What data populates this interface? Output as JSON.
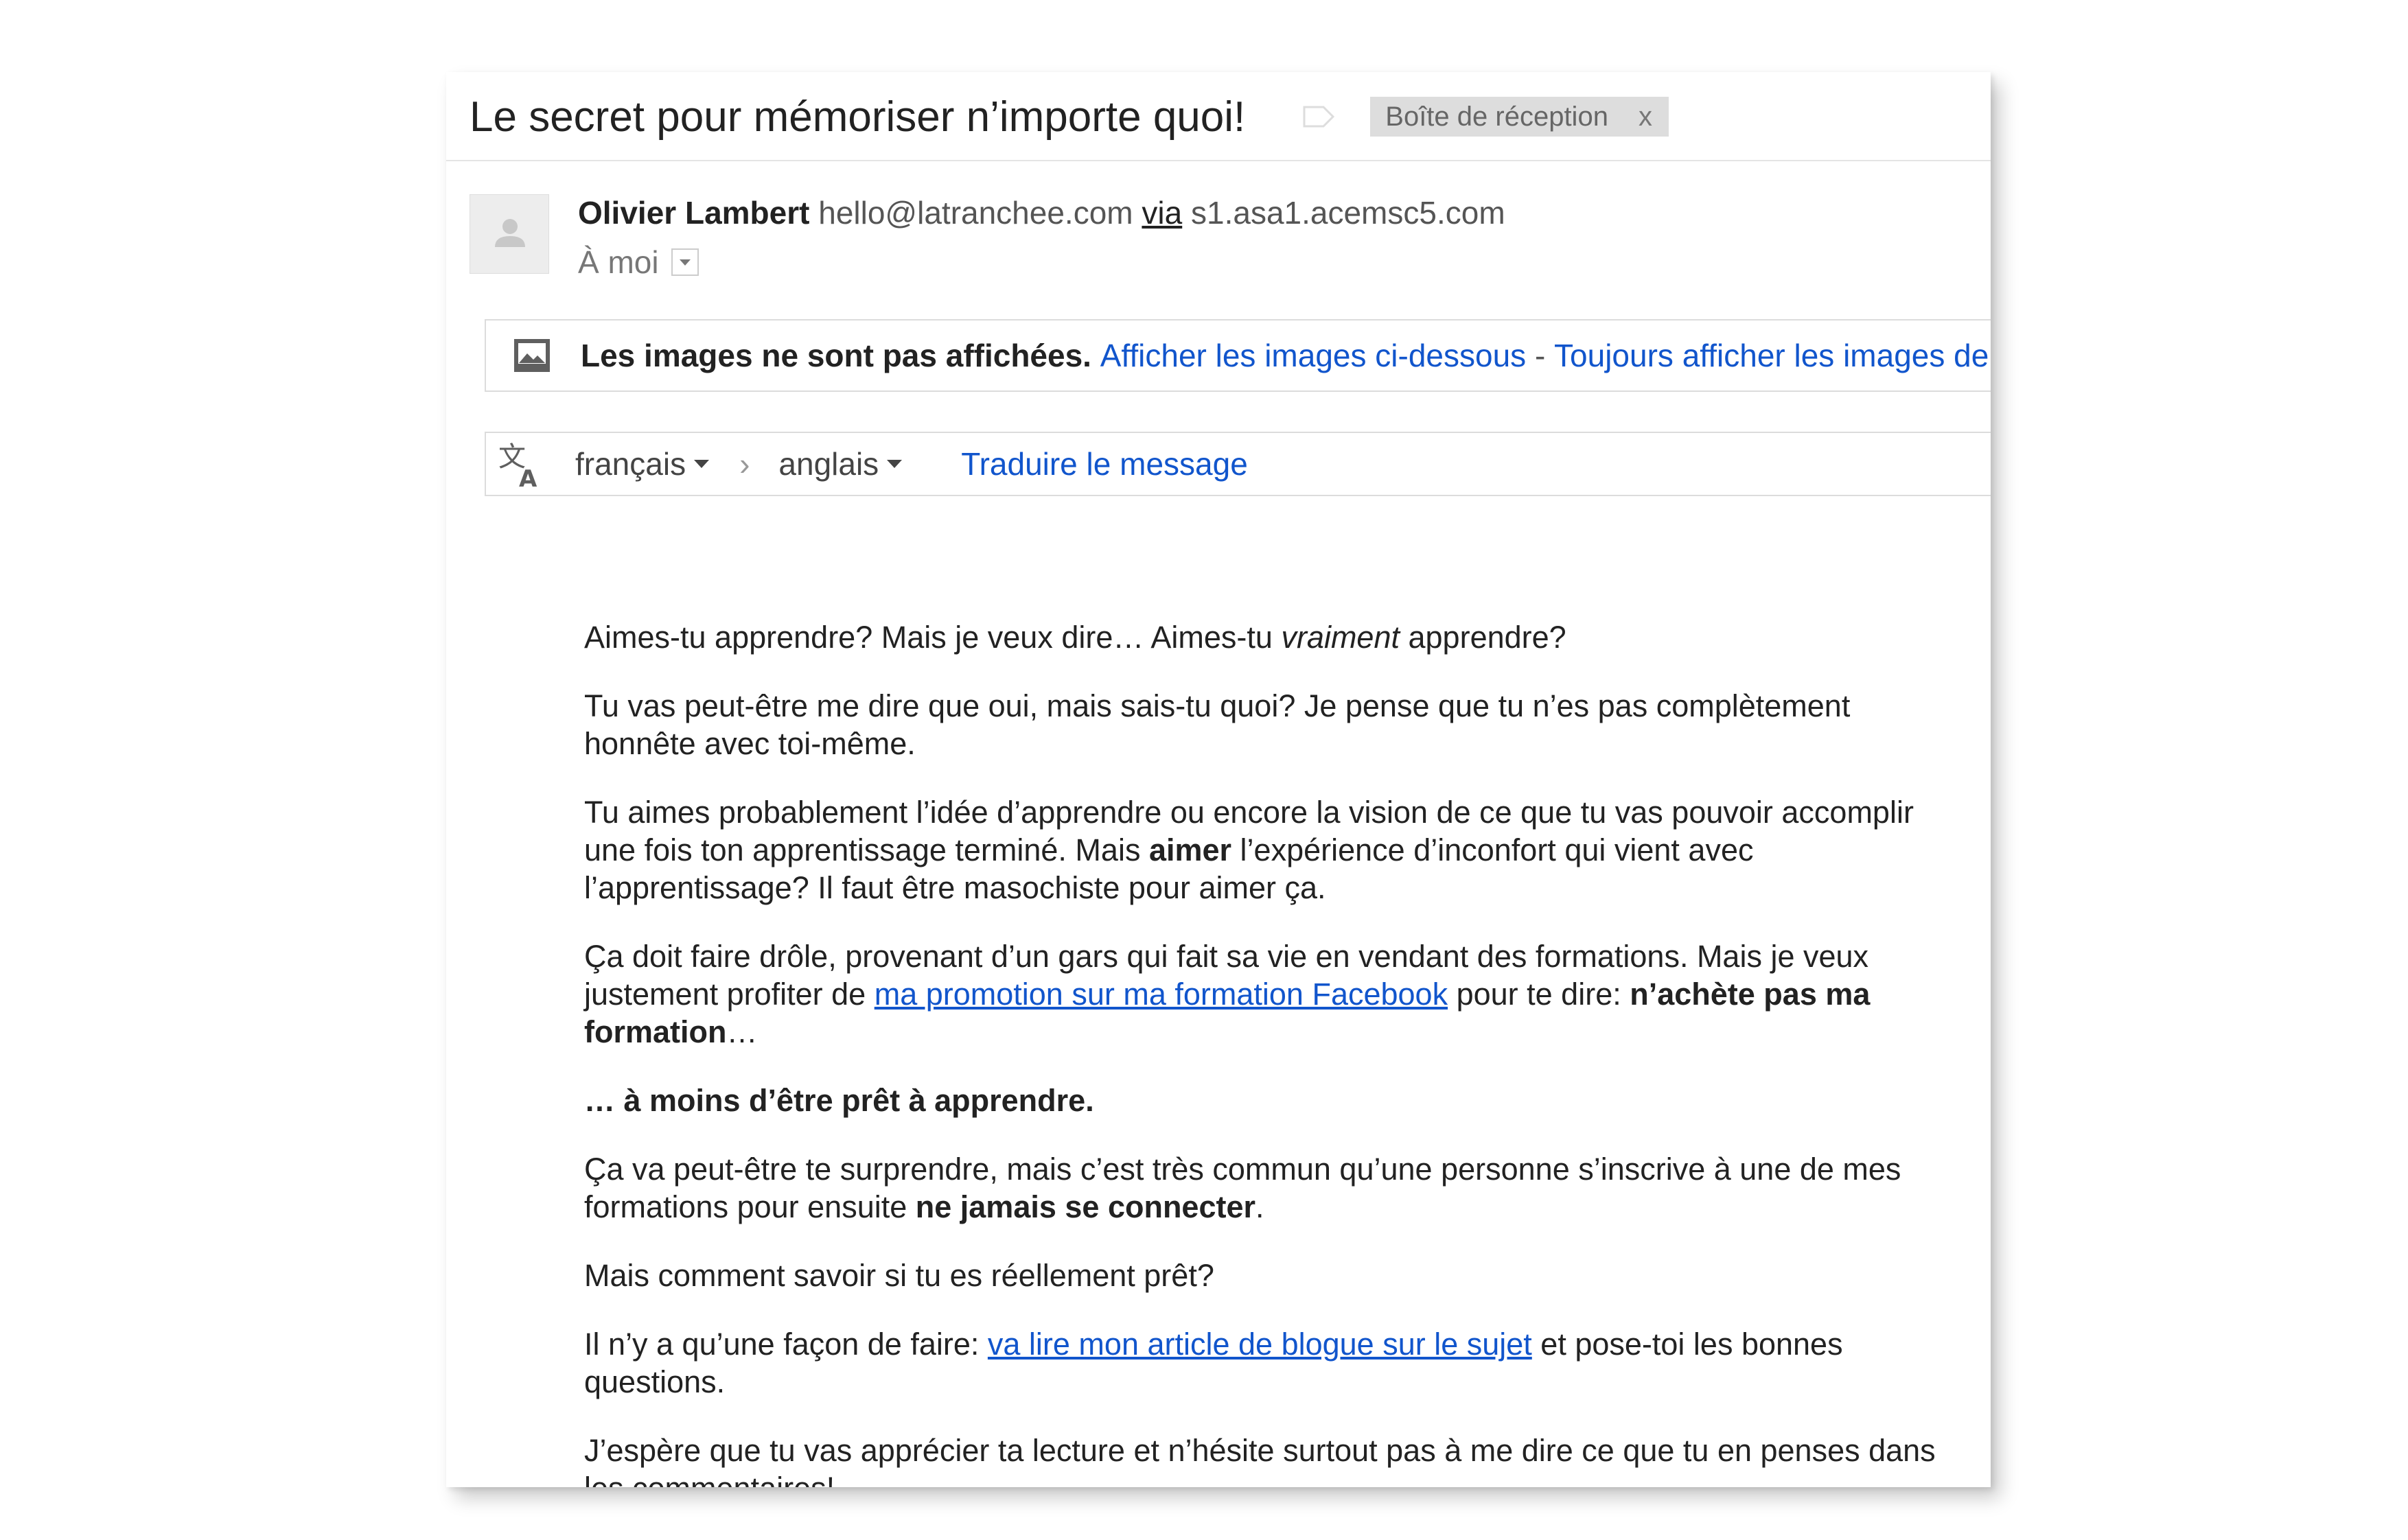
{
  "email": {
    "subject": "Le secret pour mémoriser n’importe quoi!",
    "label_chip": "Boîte de réception",
    "label_close": "x",
    "sender_name": "Olivier Lambert",
    "sender_email": "hello@latranchee.com",
    "via_label": "via",
    "via_domain": "s1.asa1.acemsc5.com",
    "to_label": "À moi"
  },
  "images_bar": {
    "notice": "Les images ne sont pas affichées.",
    "show_link": "Afficher les images ci-dessous",
    "separator": "-",
    "always_link": "Toujours afficher les images de"
  },
  "translate_bar": {
    "from_lang": "français",
    "to_lang": "anglais",
    "chevron": "›",
    "translate_link": "Traduire le message"
  },
  "body": {
    "p1_a": "Aimes-tu apprendre? Mais je veux dire… Aimes-tu ",
    "p1_em": "vraiment",
    "p1_b": " apprendre?",
    "p2": "Tu vas peut-être me dire que oui, mais sais-tu quoi? Je pense que tu n’es pas complètement honnête avec toi-même.",
    "p3_a": "Tu aimes probablement l’idée d’apprendre ou encore la vision de ce que tu vas pouvoir accomplir une fois ton apprentissage terminé. Mais ",
    "p3_strong": "aimer",
    "p3_b": " l’expérience d’inconfort qui vient avec l’apprentissage? Il faut être masochiste pour aimer ça.",
    "p4_a": "Ça doit faire drôle, provenant d’un gars qui fait sa vie en vendant des formations. Mais je veux justement profiter de ",
    "p4_link": "ma promotion sur ma formation Facebook",
    "p4_b": " pour te dire: ",
    "p4_strong": "n’achète pas ma formation",
    "p4_c": "…",
    "p5": "… à moins d’être prêt à apprendre.",
    "p6_a": "Ça va peut-être te surprendre, mais c’est très commun qu’une personne s’inscrive à une de mes formations pour ensuite ",
    "p6_strong": "ne jamais se connecter",
    "p6_b": ".",
    "p7": "Mais comment savoir si tu es réellement prêt?",
    "p8_a": "Il n’y a qu’une façon de faire: ",
    "p8_link": "va lire mon article de blogue sur le sujet",
    "p8_b": " et pose-toi les bonnes questions.",
    "p9": "J’espère que tu vas apprécier ta lecture et n’hésite surtout pas à me dire ce que tu en penses dans les commentaires!"
  },
  "colors": {
    "link": "#1155cc",
    "chip_bg": "#dddddd",
    "text": "#222222"
  },
  "icons": {
    "label": "label-outline-icon",
    "avatar": "default-avatar-icon",
    "image": "image-icon",
    "translate": "translate-icon",
    "dropdown": "dropdown-arrow-icon"
  }
}
